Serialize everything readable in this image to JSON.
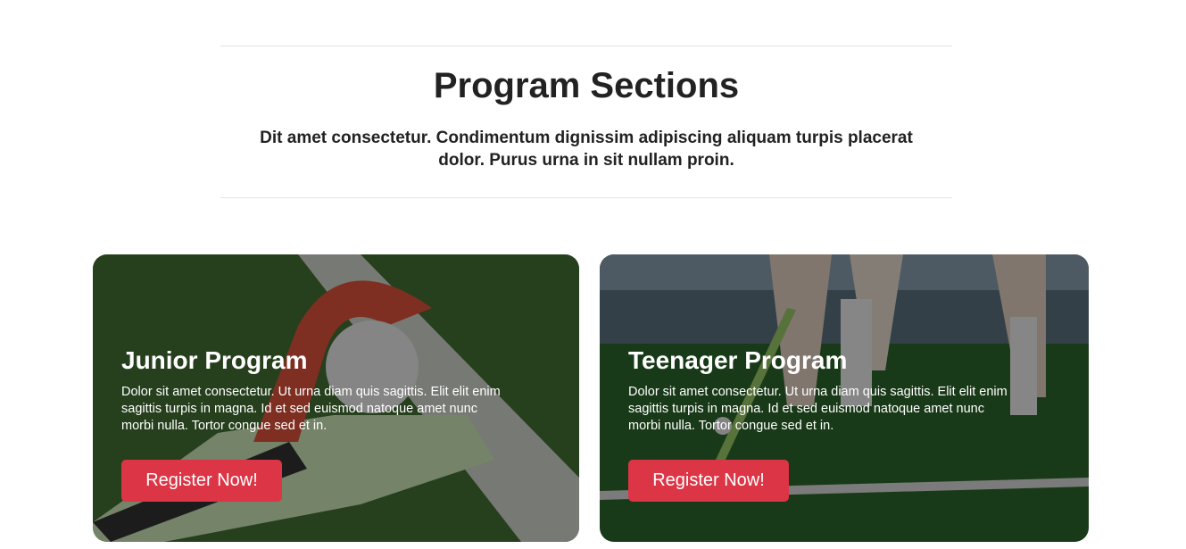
{
  "section": {
    "title": "Program Sections",
    "subtitle": "Dit amet consectetur. Condimentum dignissim adipiscing aliquam turpis placerat dolor. Purus urna in sit nullam proin."
  },
  "cards": [
    {
      "title": "Junior Program",
      "desc_line1": "Dolor sit amet consectetur. Ut urna diam quis sagittis. Elit elit enim sagittis turpis in magna. Id et sed euismod natoque amet nunc",
      "desc_line2": "morbi nulla. Tortor congue sed et in.",
      "button": "Register Now!"
    },
    {
      "title": "Teenager Program",
      "desc_line1": "Dolor sit amet consectetur. Ut urna diam quis sagittis. Elit elit enim sagittis turpis in magna. Id et sed euismod natoque amet nunc",
      "desc_line2": "morbi nulla. Tortor congue sed et in.",
      "button": "Register Now!"
    }
  ],
  "colors": {
    "accent": "#dc3545"
  }
}
